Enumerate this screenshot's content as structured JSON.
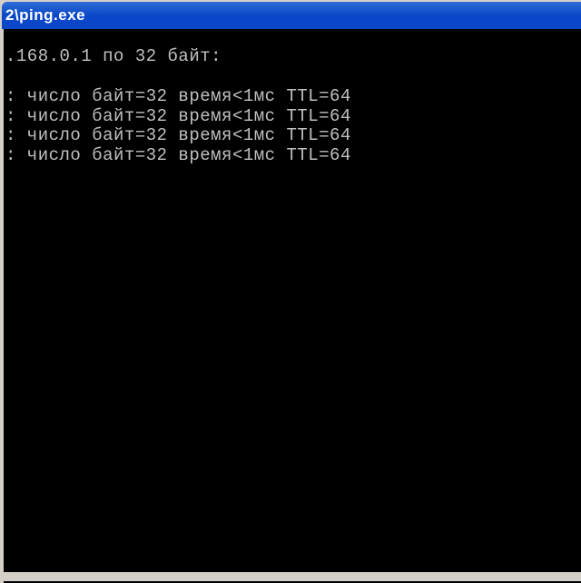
{
  "window": {
    "title": "2\\ping.exe"
  },
  "console": {
    "header_line": ".168.0.1 по 32 байт:",
    "reply_lines": [
      ": число байт=32 время<1мс TTL=64",
      ": число байт=32 время<1мс TTL=64",
      ": число байт=32 время<1мс TTL=64",
      ": число байт=32 время<1мс TTL=64"
    ]
  }
}
